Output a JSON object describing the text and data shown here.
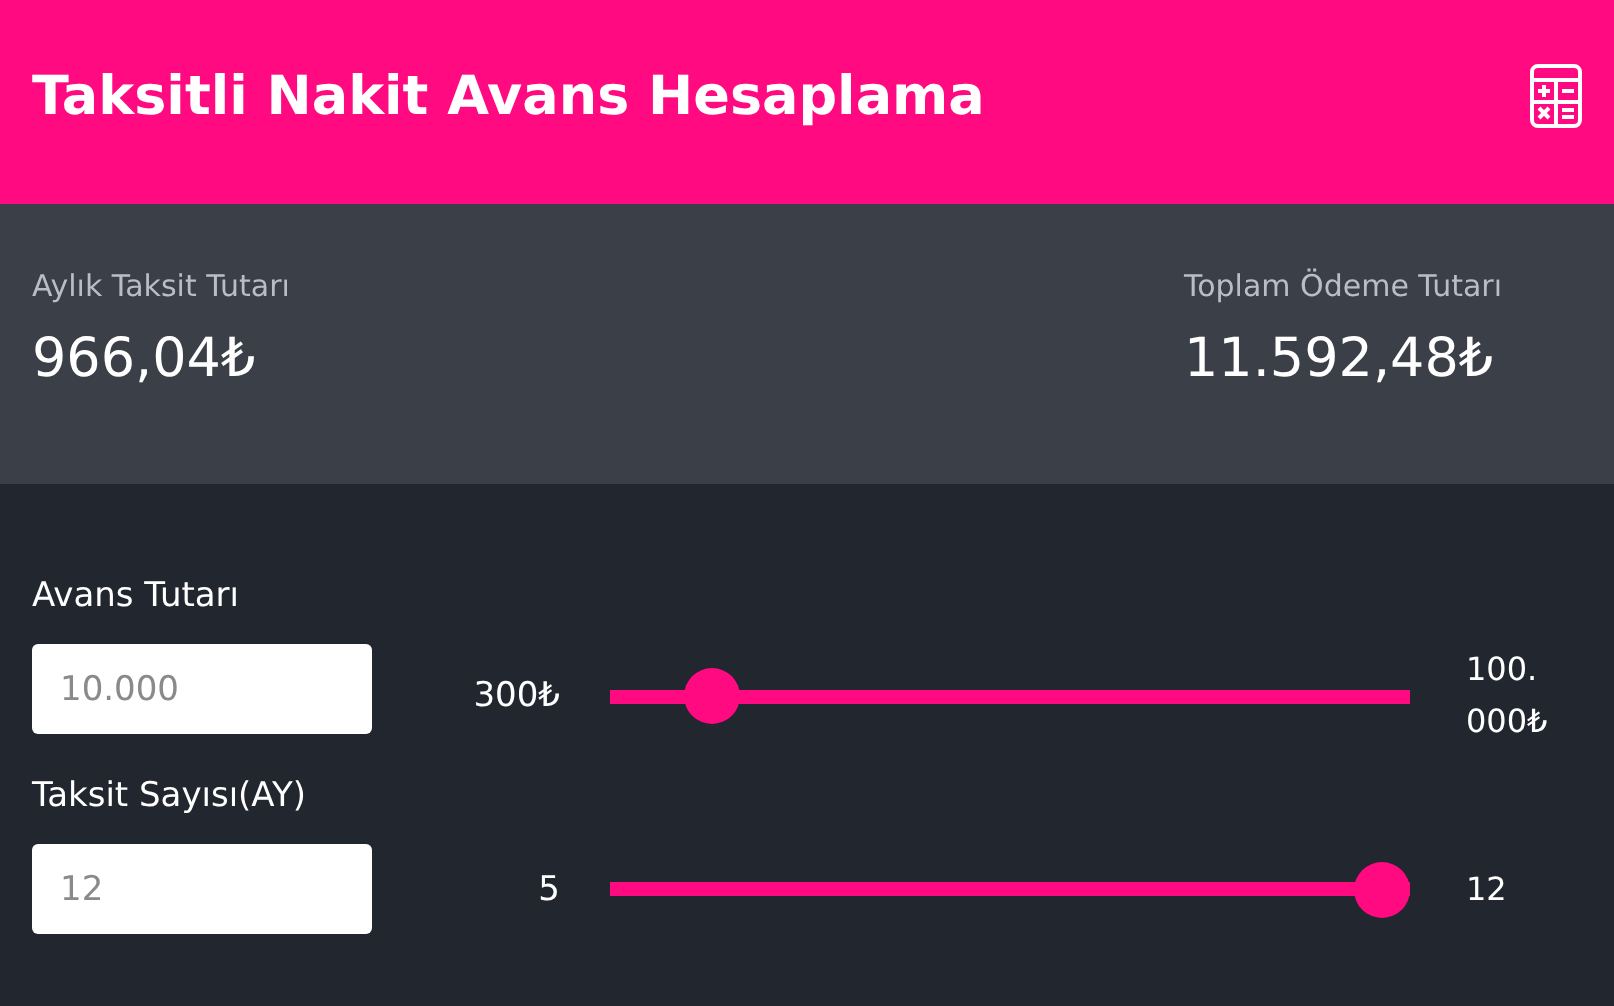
{
  "header": {
    "title": "Taksitli Nakit Avans Hesaplama"
  },
  "summary": [
    {
      "label": "Aylık Taksit Tutarı",
      "value": "966,04₺"
    },
    {
      "label": "Toplam Ödeme Tutarı",
      "value": "11.592,48₺"
    }
  ],
  "inputs": [
    {
      "label": "Avans Tutarı",
      "placeholder": "10.000",
      "min": "300₺",
      "max": "100.000₺",
      "level": 0.1
    },
    {
      "label": "Taksit Sayısı(AY)",
      "placeholder": "12",
      "min": "5",
      "max": "12",
      "level": 1
    }
  ]
}
